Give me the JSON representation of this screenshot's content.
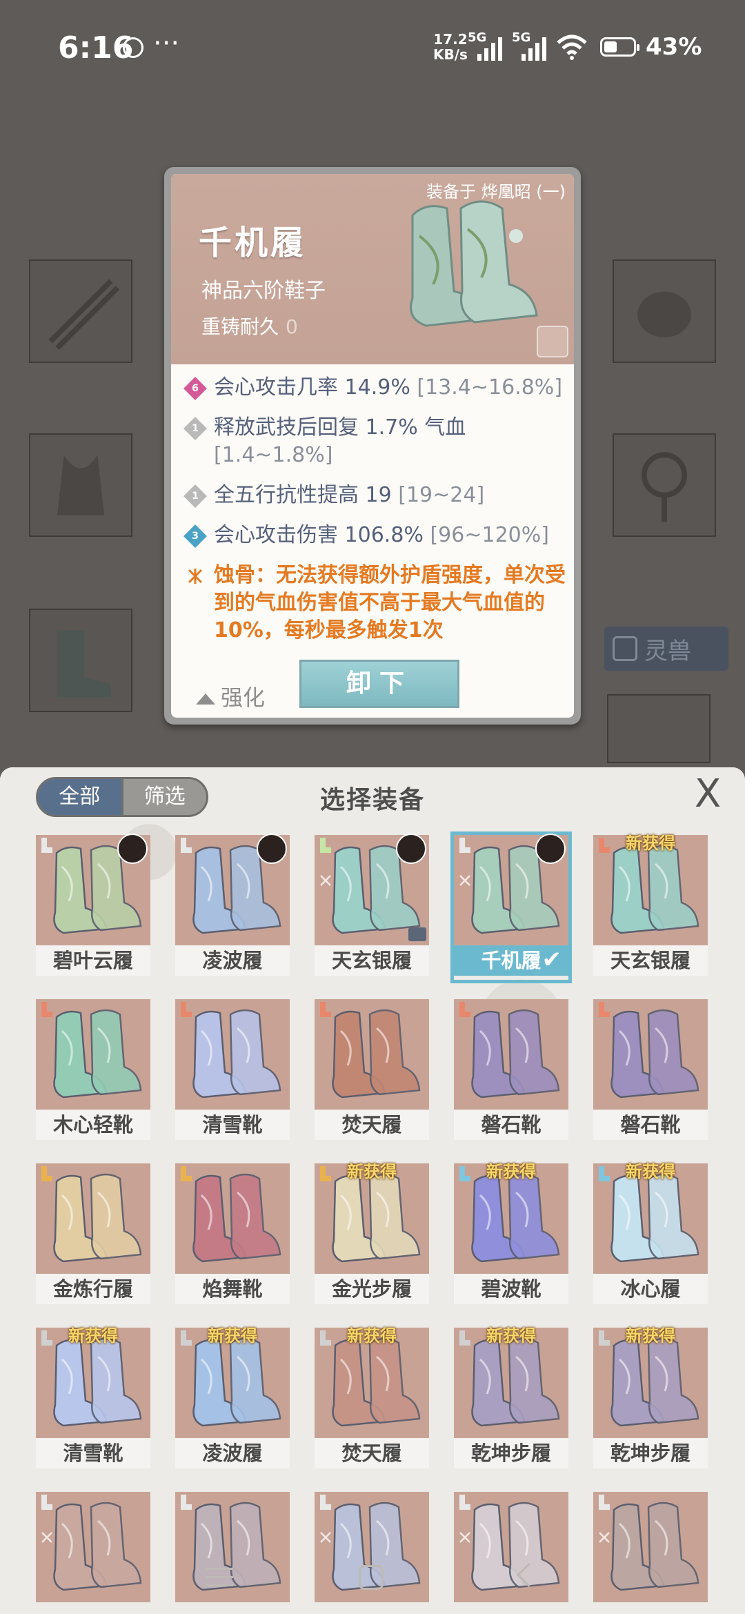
{
  "status_bar": {
    "time": "6:16",
    "more": "···",
    "net_speed_value": "17.2",
    "net_speed_unit": "KB/s",
    "sim1": "5G",
    "sim2": "5G",
    "battery_pct": "43%"
  },
  "background": {
    "pet_label": "灵兽"
  },
  "detail": {
    "equipped_by": "装备于 烨凰昭 (一)",
    "name": "千机履",
    "grade": "神品六阶鞋子",
    "recast_label": "重铸耐久",
    "recast_value": "0",
    "attributes": [
      {
        "level": "6",
        "level_color": "#d35a97",
        "text": "会心攻击几率 14.9% ",
        "range": "[13.4~16.8%]"
      },
      {
        "level": "1",
        "level_color": "#b9b9b9",
        "text": "释放武技后回复 1.7% 气血 ",
        "range": "[1.4~1.8%]"
      },
      {
        "level": "1",
        "level_color": "#b9b9b9",
        "text": "全五行抗性提高 19 ",
        "range": "[19~24]"
      },
      {
        "level": "3",
        "level_color": "#4aa2c6",
        "text": "会心攻击伤害 106.8% ",
        "range": "[96~120%]"
      }
    ],
    "special": "蚀骨：无法获得额外护盾强度，单次受到的气血伤害值不高于最大气血值的10%，每秒最多触发1次",
    "strengthen_label": "强化",
    "unequip_label": "卸下"
  },
  "panel": {
    "filter_all": "全部",
    "filter_screen": "筛选",
    "title": "选择装备",
    "close": "X",
    "new_badge": "新获得",
    "items": [
      {
        "name": "碧叶云履",
        "color": "#b9cfa7",
        "slot": "#e8e8e8",
        "avatar": true,
        "new": false,
        "lock": false,
        "gem": false,
        "selected": false
      },
      {
        "name": "凌波履",
        "color": "#a8bfdf",
        "slot": "#e8e8e8",
        "avatar": true,
        "new": false,
        "lock": false,
        "gem": false,
        "selected": false
      },
      {
        "name": "天玄银履",
        "color": "#9ccfc6",
        "slot": "#c7e6a6",
        "avatar": true,
        "new": false,
        "lock": true,
        "gem": true,
        "selected": false
      },
      {
        "name": "千机履",
        "color": "#a7cdbb",
        "slot": "#e8e8e8",
        "avatar": true,
        "new": false,
        "lock": false,
        "gem": true,
        "selected": true
      },
      {
        "name": "天玄银履",
        "color": "#9ccfc6",
        "slot": "#e8876b",
        "avatar": false,
        "new": true,
        "lock": false,
        "gem": false,
        "selected": false
      },
      {
        "name": "木心轻靴",
        "color": "#93cbb5",
        "slot": "#e8876b",
        "avatar": false,
        "new": false,
        "lock": false,
        "gem": false,
        "selected": false
      },
      {
        "name": "清雪靴",
        "color": "#b8c2e6",
        "slot": "#e8876b",
        "avatar": false,
        "new": false,
        "lock": false,
        "gem": false,
        "selected": false
      },
      {
        "name": "焚天履",
        "color": "#c28773",
        "slot": "#e8876b",
        "avatar": false,
        "new": false,
        "lock": false,
        "gem": false,
        "selected": false
      },
      {
        "name": "磐石靴",
        "color": "#9d8fbe",
        "slot": "#e8876b",
        "avatar": false,
        "new": false,
        "lock": false,
        "gem": false,
        "selected": false
      },
      {
        "name": "磐石靴",
        "color": "#9d8fbe",
        "slot": "#e8876b",
        "avatar": false,
        "new": false,
        "lock": false,
        "gem": false,
        "selected": false
      },
      {
        "name": "金炼行履",
        "color": "#e2cda3",
        "slot": "#e9b24e",
        "avatar": false,
        "new": false,
        "lock": false,
        "gem": false,
        "selected": false
      },
      {
        "name": "焰舞靴",
        "color": "#c47b86",
        "slot": "#e9b24e",
        "avatar": false,
        "new": false,
        "lock": false,
        "gem": false,
        "selected": false
      },
      {
        "name": "金光步履",
        "color": "#e3d8b8",
        "slot": "#e9b24e",
        "avatar": false,
        "new": true,
        "lock": false,
        "gem": false,
        "selected": false
      },
      {
        "name": "碧波靴",
        "color": "#8f8fdc",
        "slot": "#7fc6df",
        "avatar": false,
        "new": true,
        "lock": false,
        "gem": false,
        "selected": false
      },
      {
        "name": "冰心履",
        "color": "#c6e1ee",
        "slot": "#7fc6df",
        "avatar": false,
        "new": true,
        "lock": false,
        "gem": false,
        "selected": false
      },
      {
        "name": "清雪靴",
        "color": "#b8c6ec",
        "slot": "#d0d0d0",
        "avatar": false,
        "new": true,
        "lock": false,
        "gem": false,
        "selected": false
      },
      {
        "name": "凌波履",
        "color": "#a5c2e6",
        "slot": "#d0d0d0",
        "avatar": false,
        "new": true,
        "lock": false,
        "gem": false,
        "selected": false
      },
      {
        "name": "焚天履",
        "color": "#c69387",
        "slot": "#d0d0d0",
        "avatar": false,
        "new": true,
        "lock": false,
        "gem": false,
        "selected": false
      },
      {
        "name": "乾坤步履",
        "color": "#a99fc0",
        "slot": "#d0d0d0",
        "avatar": false,
        "new": true,
        "lock": false,
        "gem": false,
        "selected": false
      },
      {
        "name": "乾坤步履",
        "color": "#a99fc0",
        "slot": "#d0d0d0",
        "avatar": false,
        "new": true,
        "lock": false,
        "gem": false,
        "selected": false
      },
      {
        "name": "",
        "color": "#c9a8a0",
        "slot": "#e8e8e8",
        "avatar": false,
        "new": false,
        "lock": false,
        "gem": true,
        "selected": false
      },
      {
        "name": "",
        "color": "#bfb1b8",
        "slot": "#e8e8e8",
        "avatar": false,
        "new": false,
        "lock": false,
        "gem": false,
        "selected": false
      },
      {
        "name": "",
        "color": "#b9c0d8",
        "slot": "#e8e8e8",
        "avatar": false,
        "new": false,
        "lock": false,
        "gem": true,
        "selected": false
      },
      {
        "name": "",
        "color": "#d4ccd0",
        "slot": "#e8e8e8",
        "avatar": false,
        "new": false,
        "lock": false,
        "gem": true,
        "selected": false
      },
      {
        "name": "",
        "color": "#bba6a2",
        "slot": "#e8e8e8",
        "avatar": false,
        "new": false,
        "lock": false,
        "gem": true,
        "selected": false
      }
    ]
  },
  "icons": {
    "nav_menu": "menu-icon",
    "nav_home": "home-icon",
    "nav_back": "back-icon"
  }
}
